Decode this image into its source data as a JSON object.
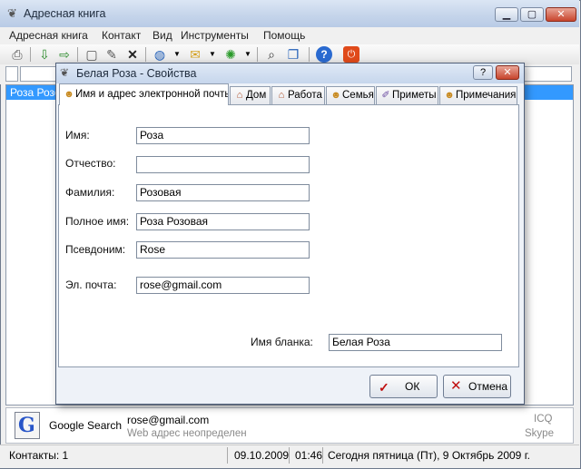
{
  "app": {
    "title": "Адресная книга",
    "window_controls": {
      "minimize": "▁",
      "maximize": "▢",
      "close": "✕"
    }
  },
  "menu": [
    "Адресная книга",
    "Контакт",
    "Вид",
    "Инструменты",
    "Помощь"
  ],
  "toolbar_icons": [
    "print-icon",
    "import-icon",
    "export-icon",
    "new-contact-icon",
    "edit-contact-icon",
    "delete-icon",
    "globe-icon",
    "mail-icon",
    "network-icon",
    "find-icon",
    "copy-icon",
    "help-icon",
    "power-icon"
  ],
  "contact_list": {
    "selected": "Роза  Розо"
  },
  "dialog": {
    "title": "Белая Роза - Свойства",
    "help": "?",
    "close": "✕",
    "tabs": [
      {
        "label": "Имя и адрес электронной почты",
        "icon": "person-icon"
      },
      {
        "label": "Дом",
        "icon": "home-icon"
      },
      {
        "label": "Работа",
        "icon": "work-icon"
      },
      {
        "label": "Семья",
        "icon": "family-icon"
      },
      {
        "label": "Приметы",
        "icon": "features-icon"
      },
      {
        "label": "Примечания",
        "icon": "notes-icon"
      }
    ],
    "fields": {
      "first_name": {
        "label": "Имя:",
        "value": "Роза"
      },
      "middle_name": {
        "label": "Отчество:",
        "value": ""
      },
      "last_name": {
        "label": "Фамилия:",
        "value": "Розовая"
      },
      "full_name": {
        "label": "Полное имя:",
        "value": "Роза  Розовая"
      },
      "nickname": {
        "label": "Псевдоним:",
        "value": "Rose"
      },
      "email": {
        "label": "Эл. почта:",
        "value": "rose@gmail.com"
      },
      "form_name": {
        "label": "Имя бланка:",
        "value": "Белая Роза"
      }
    },
    "ok": "ОК",
    "cancel": "Отмена"
  },
  "info_panel": {
    "search": "Google Search",
    "email": "rose@gmail.com",
    "web": "Web адрес неопределен",
    "icq": "ICQ",
    "skype": "Skype"
  },
  "status": {
    "contacts": "Контакты: 1",
    "date": "09.10.2009",
    "time": "01:46",
    "today": "Сегодня пятница (Пт), 9 Октябрь 2009 г."
  },
  "colors": {
    "selection": "#3399ff",
    "ok_check": "#c01010",
    "cancel_x": "#c01010"
  }
}
